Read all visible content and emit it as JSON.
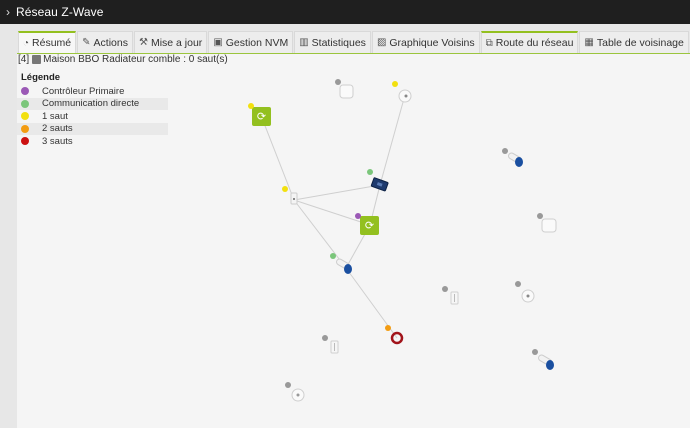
{
  "app": {
    "title": "Réseau Z-Wave"
  },
  "tabs": [
    {
      "label": "Résumé",
      "icon": "gauge-icon",
      "glyph": "◔"
    },
    {
      "label": "Actions",
      "icon": "wrench-icon",
      "glyph": "✎"
    },
    {
      "label": "Mise a jour",
      "icon": "tools-icon",
      "glyph": "⚒"
    },
    {
      "label": "Gestion NVM",
      "icon": "save-icon",
      "glyph": "▣"
    },
    {
      "label": "Statistiques",
      "icon": "bar-chart-icon",
      "glyph": "▥"
    },
    {
      "label": "Graphique Voisins",
      "icon": "image-icon",
      "glyph": "▨"
    },
    {
      "label": "Route du réseau",
      "icon": "sitemap-icon",
      "glyph": "⧉"
    },
    {
      "label": "Table de voisinage",
      "icon": "table-icon",
      "glyph": "▦"
    }
  ],
  "node_info": {
    "id": "[4]",
    "text": "Maison BBO Radiateur comble : 0 saut(s)"
  },
  "legend": {
    "title": "Légende",
    "items": [
      {
        "label": "Contrôleur Primaire",
        "color": "#9b59b6"
      },
      {
        "label": "Communication directe",
        "color": "#7bc67b"
      },
      {
        "label": "1 saut",
        "color": "#f2e00f"
      },
      {
        "label": "2 sauts",
        "color": "#f39c12"
      },
      {
        "label": "3 sauts",
        "color": "#cc1111"
      }
    ]
  },
  "colors": {
    "accent": "#93c01f",
    "link": "#cfcfcf",
    "unknown": "#999999"
  },
  "graph_nodes": [
    {
      "name": "node-top-center",
      "icon": "cube-icon",
      "status": "unknown"
    },
    {
      "name": "node-top-right",
      "icon": "siren-icon",
      "status": "1 saut"
    },
    {
      "name": "node-top-left",
      "icon": "green-module-icon",
      "status": "1 saut"
    },
    {
      "name": "node-right-blue-1",
      "icon": "blue-sensor-icon",
      "status": "unknown"
    },
    {
      "name": "node-center-left",
      "icon": "plug-icon",
      "status": "1 saut"
    },
    {
      "name": "node-usb-stick",
      "icon": "usb-stick-icon",
      "status": "Communication directe"
    },
    {
      "name": "node-controller",
      "icon": "green-module-icon",
      "status": "Contrôleur Primaire"
    },
    {
      "name": "node-right-white-cube",
      "icon": "cube-icon",
      "status": "unknown"
    },
    {
      "name": "node-blue-sensor-center",
      "icon": "blue-sensor-icon",
      "status": "Communication directe"
    },
    {
      "name": "node-switch-mid",
      "icon": "switch-icon",
      "status": "unknown"
    },
    {
      "name": "node-round-right",
      "icon": "siren-icon",
      "status": "unknown"
    },
    {
      "name": "node-red-ring",
      "icon": "ring-icon",
      "status": "2 sauts"
    },
    {
      "name": "node-switch-low",
      "icon": "switch-icon",
      "status": "unknown"
    },
    {
      "name": "node-right-blue-2",
      "icon": "blue-sensor-icon",
      "status": "unknown"
    },
    {
      "name": "node-round-bottom",
      "icon": "siren-icon",
      "status": "unknown"
    }
  ]
}
